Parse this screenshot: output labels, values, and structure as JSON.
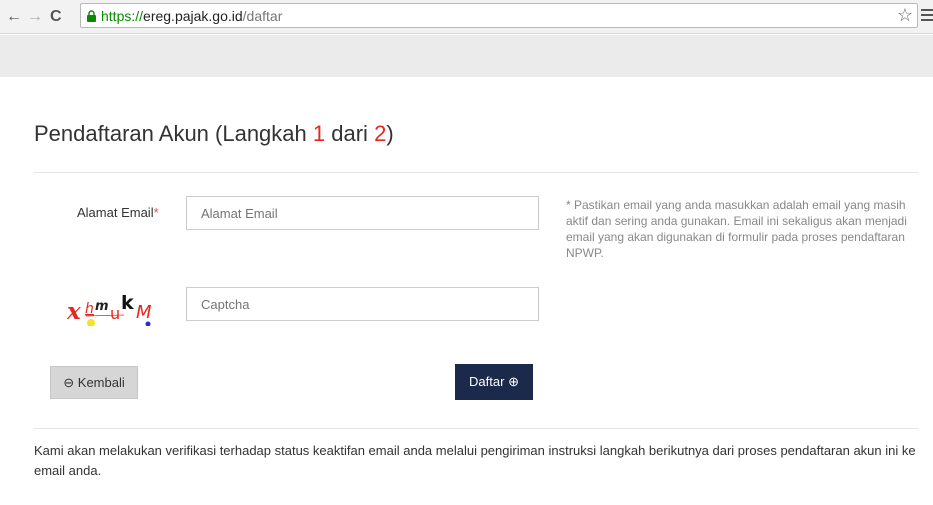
{
  "browser": {
    "url_scheme": "https://",
    "url_host": "ereg.pajak.go.id",
    "url_path": "/daftar",
    "icons": {
      "back": "back-arrow-icon",
      "forward": "forward-arrow-icon",
      "reload": "reload-icon",
      "lock": "lock-icon",
      "star": "star-icon",
      "menu": "hamburger-menu-icon"
    }
  },
  "page": {
    "title_prefix": "Pendaftaran Akun  (Langkah ",
    "step_current": "1",
    "title_mid": " dari ",
    "step_total": "2",
    "title_suffix": ")"
  },
  "form": {
    "email_label": "Alamat Email",
    "required_marker": "*",
    "email_placeholder": "Alamat Email",
    "captcha_placeholder": "Captcha",
    "captcha_text": "xhmukM",
    "help_text": "* Pastikan email yang anda masukkan adalah email yang masih aktif dan sering anda gunakan. Email ini sekaligus akan menjadi email yang akan digunakan di formulir pada proses pendaftaran NPWP.",
    "back_button": "Kembali",
    "back_icon": "circle-arrow-left-icon",
    "submit_button": "Daftar",
    "submit_icon": "circle-arrow-right-icon"
  },
  "footer_note": "Kami akan melakukan verifikasi terhadap status keaktifan email anda melalui pengiriman instruksi langkah berikutnya dari proses pendaftaran akun ini ke email anda.",
  "colors": {
    "accent_red": "#e8261d",
    "primary_button": "#1b2a4a",
    "url_green": "#0b8a00"
  }
}
